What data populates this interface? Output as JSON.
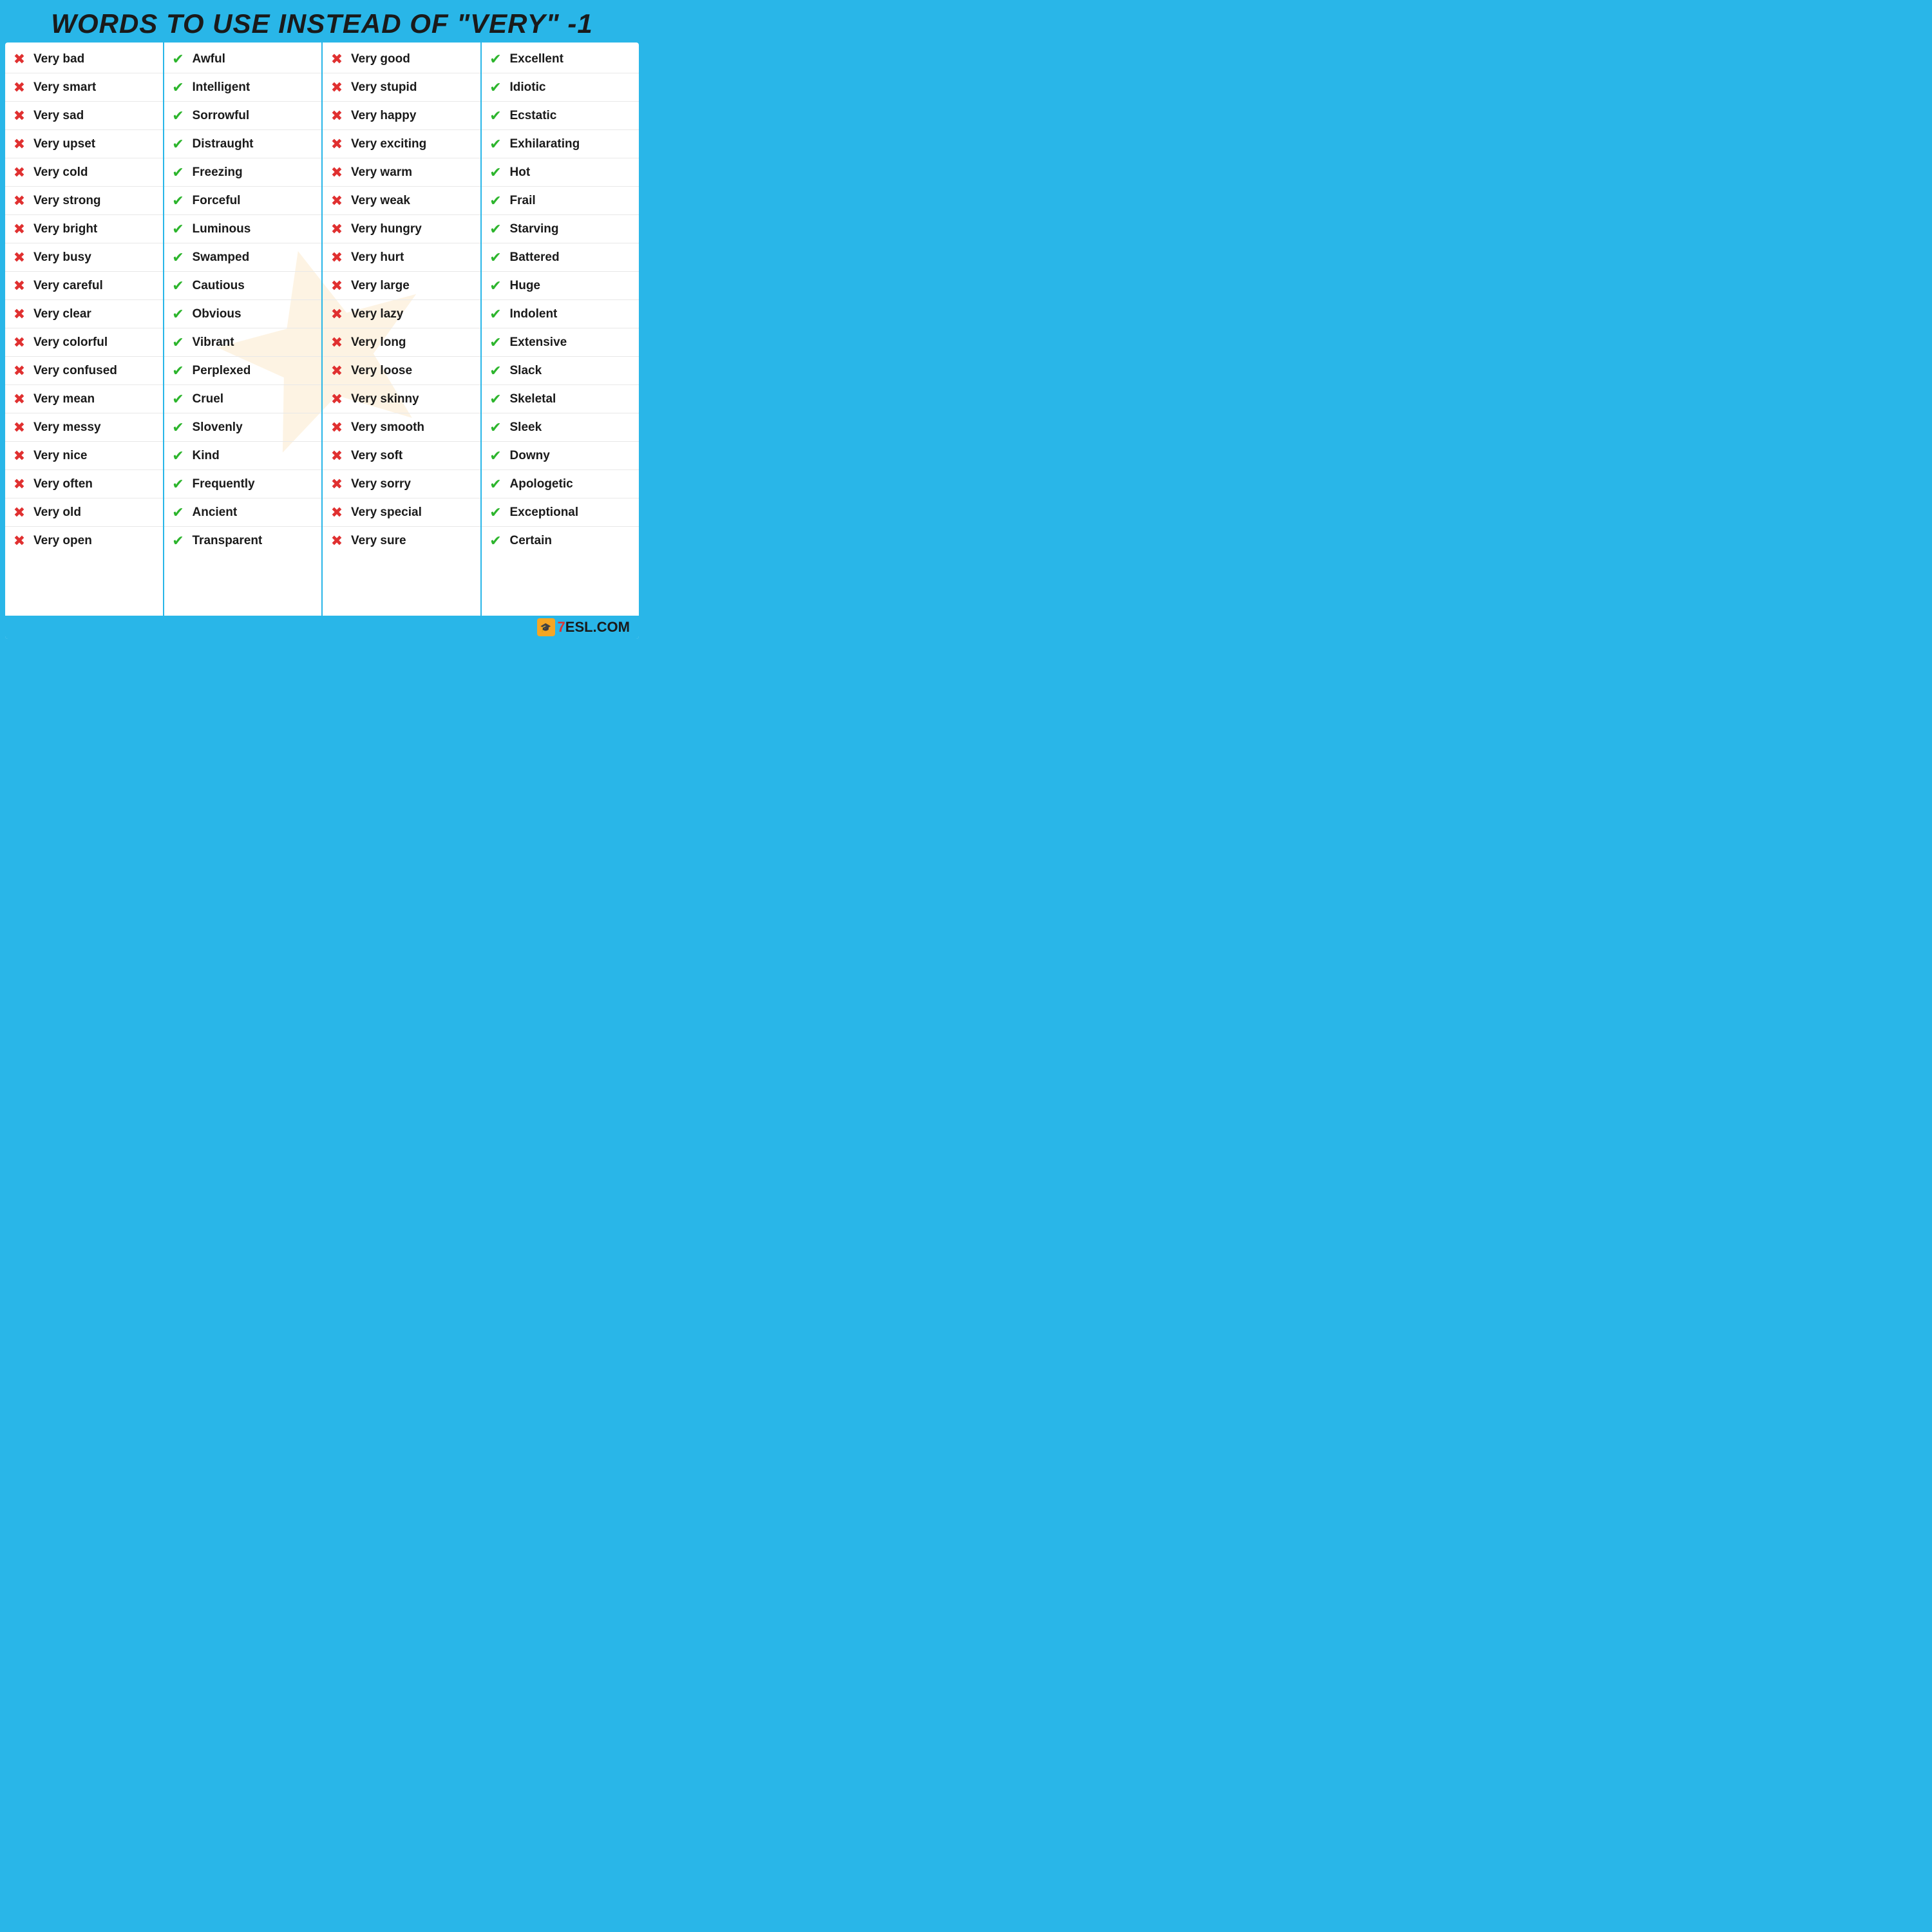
{
  "title": "WORDS TO USE INSTEAD OF \"VERY\" -1",
  "columns": [
    {
      "id": "col1",
      "items": [
        {
          "icon": "x",
          "text": "Very bad"
        },
        {
          "icon": "x",
          "text": "Very smart"
        },
        {
          "icon": "x",
          "text": "Very sad"
        },
        {
          "icon": "x",
          "text": "Very upset"
        },
        {
          "icon": "x",
          "text": "Very cold"
        },
        {
          "icon": "x",
          "text": "Very strong"
        },
        {
          "icon": "x",
          "text": "Very bright"
        },
        {
          "icon": "x",
          "text": "Very busy"
        },
        {
          "icon": "x",
          "text": "Very careful"
        },
        {
          "icon": "x",
          "text": "Very clear"
        },
        {
          "icon": "x",
          "text": "Very colorful"
        },
        {
          "icon": "x",
          "text": "Very confused"
        },
        {
          "icon": "x",
          "text": "Very mean"
        },
        {
          "icon": "x",
          "text": "Very messy"
        },
        {
          "icon": "x",
          "text": "Very nice"
        },
        {
          "icon": "x",
          "text": "Very often"
        },
        {
          "icon": "x",
          "text": "Very old"
        },
        {
          "icon": "x",
          "text": "Very open"
        }
      ]
    },
    {
      "id": "col2",
      "items": [
        {
          "icon": "check",
          "text": "Awful"
        },
        {
          "icon": "check",
          "text": "Intelligent"
        },
        {
          "icon": "check",
          "text": "Sorrowful"
        },
        {
          "icon": "check",
          "text": "Distraught"
        },
        {
          "icon": "check",
          "text": "Freezing"
        },
        {
          "icon": "check",
          "text": "Forceful"
        },
        {
          "icon": "check",
          "text": "Luminous"
        },
        {
          "icon": "check",
          "text": "Swamped"
        },
        {
          "icon": "check",
          "text": "Cautious"
        },
        {
          "icon": "check",
          "text": "Obvious"
        },
        {
          "icon": "check",
          "text": "Vibrant"
        },
        {
          "icon": "check",
          "text": "Perplexed"
        },
        {
          "icon": "check",
          "text": "Cruel"
        },
        {
          "icon": "check",
          "text": "Slovenly"
        },
        {
          "icon": "check",
          "text": "Kind"
        },
        {
          "icon": "check",
          "text": "Frequently"
        },
        {
          "icon": "check",
          "text": "Ancient"
        },
        {
          "icon": "check",
          "text": "Transparent"
        }
      ]
    },
    {
      "id": "col3",
      "items": [
        {
          "icon": "x",
          "text": "Very good"
        },
        {
          "icon": "x",
          "text": "Very stupid"
        },
        {
          "icon": "x",
          "text": "Very happy"
        },
        {
          "icon": "x",
          "text": "Very exciting"
        },
        {
          "icon": "x",
          "text": "Very warm"
        },
        {
          "icon": "x",
          "text": "Very weak"
        },
        {
          "icon": "x",
          "text": "Very hungry"
        },
        {
          "icon": "x",
          "text": "Very hurt"
        },
        {
          "icon": "x",
          "text": "Very large"
        },
        {
          "icon": "x",
          "text": "Very lazy"
        },
        {
          "icon": "x",
          "text": "Very long"
        },
        {
          "icon": "x",
          "text": "Very loose"
        },
        {
          "icon": "x",
          "text": "Very skinny"
        },
        {
          "icon": "x",
          "text": "Very smooth"
        },
        {
          "icon": "x",
          "text": "Very soft"
        },
        {
          "icon": "x",
          "text": "Very sorry"
        },
        {
          "icon": "x",
          "text": "Very special"
        },
        {
          "icon": "x",
          "text": "Very sure"
        }
      ]
    },
    {
      "id": "col4",
      "items": [
        {
          "icon": "check",
          "text": "Excellent"
        },
        {
          "icon": "check",
          "text": "Idiotic"
        },
        {
          "icon": "check",
          "text": "Ecstatic"
        },
        {
          "icon": "check",
          "text": "Exhilarating"
        },
        {
          "icon": "check",
          "text": "Hot"
        },
        {
          "icon": "check",
          "text": "Frail"
        },
        {
          "icon": "check",
          "text": "Starving"
        },
        {
          "icon": "check",
          "text": "Battered"
        },
        {
          "icon": "check",
          "text": "Huge"
        },
        {
          "icon": "check",
          "text": "Indolent"
        },
        {
          "icon": "check",
          "text": "Extensive"
        },
        {
          "icon": "check",
          "text": "Slack"
        },
        {
          "icon": "check",
          "text": "Skeletal"
        },
        {
          "icon": "check",
          "text": "Sleek"
        },
        {
          "icon": "check",
          "text": "Downy"
        },
        {
          "icon": "check",
          "text": "Apologetic"
        },
        {
          "icon": "check",
          "text": "Exceptional"
        },
        {
          "icon": "check",
          "text": "Certain"
        }
      ]
    }
  ],
  "logo": {
    "icon_text": "🎓",
    "text_part1": "7",
    "text_part2": "ESL.COM"
  },
  "icon_x": "✖",
  "icon_check": "✔",
  "accent_color": "#29b6e8",
  "x_color": "#e03030",
  "check_color": "#2db52d"
}
